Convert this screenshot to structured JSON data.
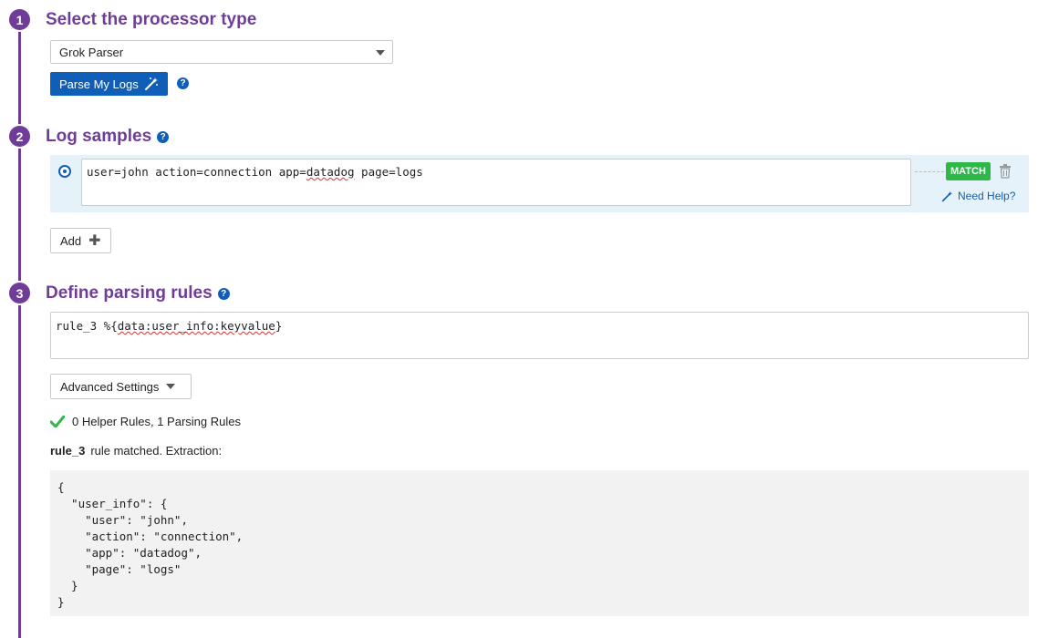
{
  "steps": [
    {
      "number": "1",
      "title": "Select the processor type"
    },
    {
      "number": "2",
      "title": "Log samples"
    },
    {
      "number": "3",
      "title": "Define parsing rules"
    }
  ],
  "processor": {
    "selected": "Grok Parser",
    "parse_button": "Parse My Logs"
  },
  "log_samples": {
    "sample_prefix": "user=john action=connection app=",
    "sample_highlight": "datadog",
    "sample_suffix": " page=logs",
    "status": "MATCH",
    "need_help": "Need Help?",
    "add_label": "Add"
  },
  "parsing": {
    "rule_prefix": "rule_3 %{",
    "rule_highlight": "data:user_info:keyvalue",
    "rule_suffix": "}",
    "advanced_label": "Advanced Settings",
    "summary": "0 Helper Rules, 1 Parsing Rules",
    "matched_rule": "rule_3",
    "matched_text": "rule matched. Extraction:",
    "extraction": "{\n  \"user_info\": {\n    \"user\": \"john\",\n    \"action\": \"connection\",\n    \"app\": \"datadog\",\n    \"page\": \"logs\"\n  }\n}"
  },
  "colors": {
    "accent": "#6f3d99",
    "primary": "#0f5fb8",
    "match": "#2eb84a"
  }
}
